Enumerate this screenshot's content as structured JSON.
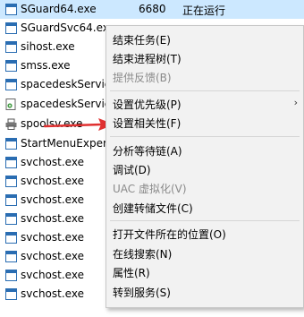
{
  "processes": [
    {
      "name": "SGuard64.exe",
      "pid": "6680",
      "status": "正在运行",
      "selected": true,
      "icon": "window-icon"
    },
    {
      "name": "SGuardSvc64.exe",
      "pid": "",
      "status": "",
      "icon": "window-icon"
    },
    {
      "name": "sihost.exe",
      "pid": "",
      "status": "",
      "icon": "window-icon"
    },
    {
      "name": "smss.exe",
      "pid": "",
      "status": "",
      "icon": "window-icon"
    },
    {
      "name": "spacedeskServic",
      "pid": "",
      "status": "",
      "icon": "window-icon"
    },
    {
      "name": "spacedeskServic",
      "pid": "",
      "status": "",
      "icon": "gear-document-icon"
    },
    {
      "name": "spoolsv.exe",
      "pid": "",
      "status": "",
      "icon": "printer-icon"
    },
    {
      "name": "StartMenuExper",
      "pid": "",
      "status": "",
      "icon": "window-icon"
    },
    {
      "name": "svchost.exe",
      "pid": "",
      "status": "",
      "icon": "window-icon"
    },
    {
      "name": "svchost.exe",
      "pid": "",
      "status": "",
      "icon": "window-icon"
    },
    {
      "name": "svchost.exe",
      "pid": "",
      "status": "",
      "icon": "window-icon"
    },
    {
      "name": "svchost.exe",
      "pid": "",
      "status": "",
      "icon": "window-icon"
    },
    {
      "name": "svchost.exe",
      "pid": "",
      "status": "",
      "icon": "window-icon"
    },
    {
      "name": "svchost.exe",
      "pid": "",
      "status": "",
      "icon": "window-icon"
    },
    {
      "name": "svchost.exe",
      "pid": "",
      "status": "",
      "icon": "window-icon"
    },
    {
      "name": "svchost.exe",
      "pid": "",
      "status": "",
      "icon": "window-icon"
    }
  ],
  "context_menu": {
    "end_task": "结束任务(E)",
    "end_process_tree": "结束进程树(T)",
    "provide_feedback": "提供反馈(B)",
    "set_priority": "设置优先级(P)",
    "set_affinity": "设置相关性(F)",
    "analyze_wait_chain": "分析等待链(A)",
    "debug": "调试(D)",
    "uac_virtualization": "UAC 虚拟化(V)",
    "create_dump_file": "创建转储文件(C)",
    "open_file_location": "打开文件所在的位置(O)",
    "search_online": "在线搜索(N)",
    "properties": "属性(R)",
    "go_to_services": "转到服务(S)",
    "submenu_arrow": "›"
  },
  "colors": {
    "selection": "#cce8ff",
    "menu_bg": "#f2f2f2",
    "disabled_text": "#8a8a8a",
    "arrow": "#e03030"
  }
}
